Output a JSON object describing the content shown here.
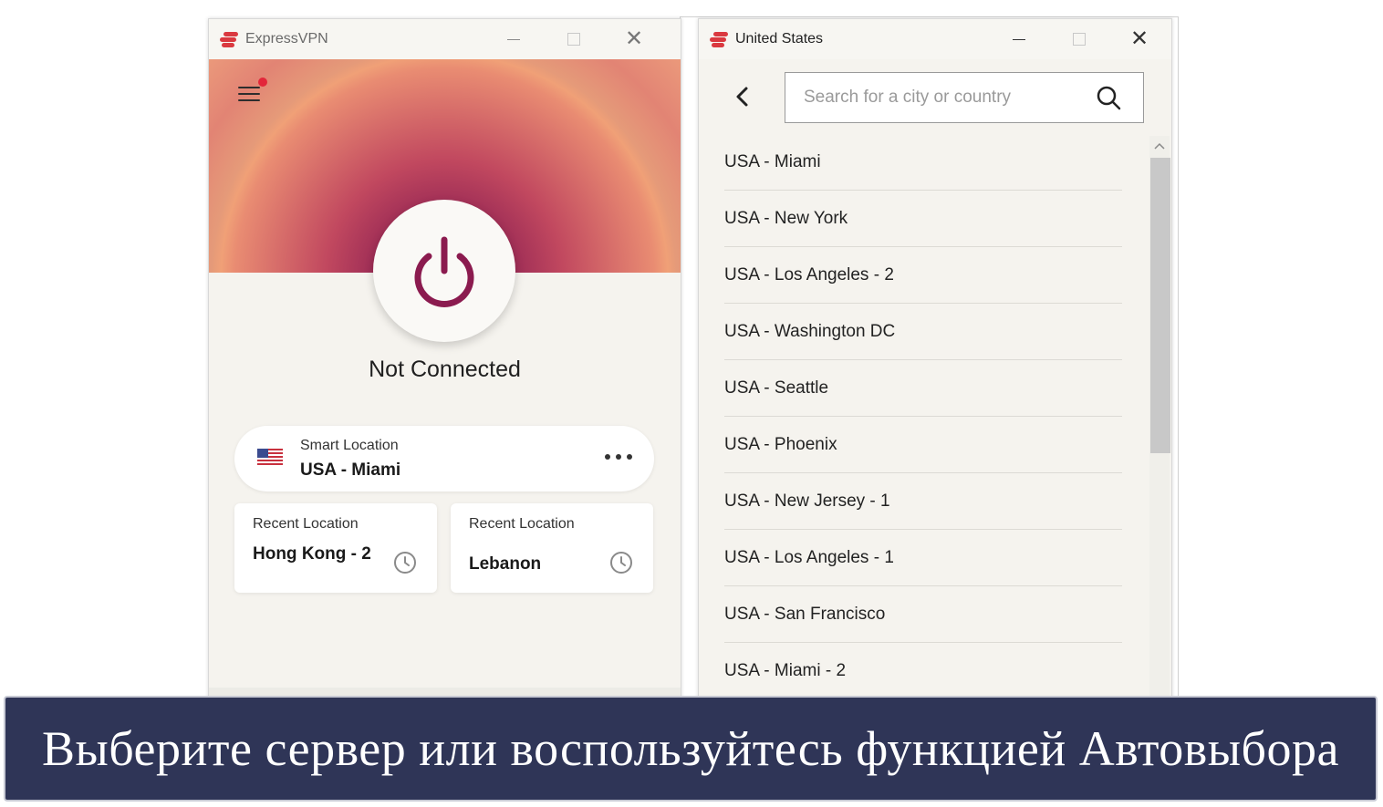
{
  "left_window": {
    "title": "ExpressVPN",
    "status": "Not Connected",
    "smart_location": {
      "label": "Smart Location",
      "value": "USA - Miami",
      "flag_icon": "us-flag-icon"
    },
    "recent": [
      {
        "label": "Recent Location",
        "value": "Hong Kong - 2"
      },
      {
        "label": "Recent Location",
        "value": "Lebanon"
      }
    ],
    "colors": {
      "brand_red": "#da3940",
      "power_icon": "#8b1b4f"
    }
  },
  "right_window": {
    "title": "United States",
    "search": {
      "placeholder": "Search for a city or country",
      "value": ""
    },
    "locations": [
      "USA - Miami",
      "USA - New York",
      "USA - Los Angeles - 2",
      "USA - Washington DC",
      "USA - Seattle",
      "USA - Phoenix",
      "USA - New Jersey - 1",
      "USA - Los Angeles - 1",
      "USA - San Francisco",
      "USA - Miami - 2"
    ]
  },
  "caption": {
    "text": "Выберите сервер или воспользуйтесь функцией Автовыбора",
    "background": "#2f3557"
  }
}
